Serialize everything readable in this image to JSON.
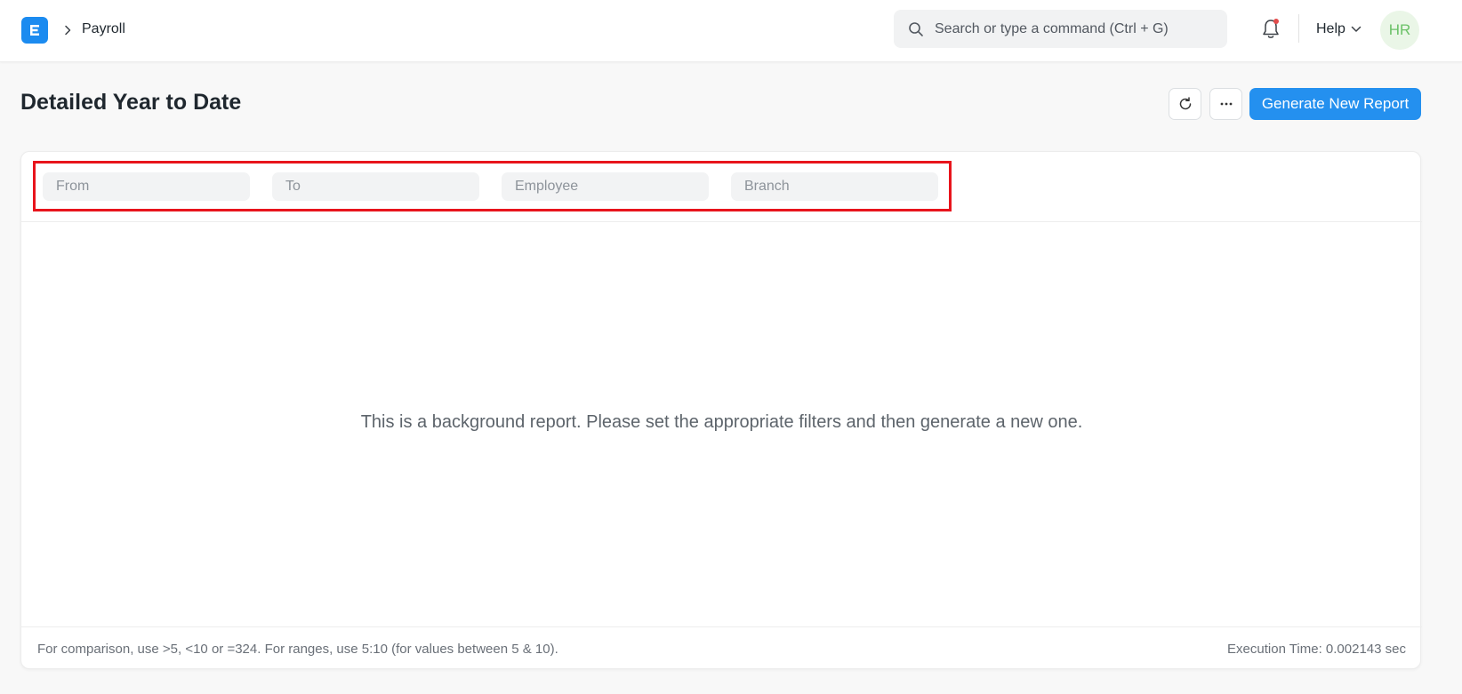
{
  "navbar": {
    "logo_letter": "E",
    "breadcrumb": "Payroll",
    "search_placeholder": "Search or type a command (Ctrl + G)",
    "help_label": "Help",
    "avatar_initials": "HR",
    "accent_color": "#2490ef",
    "notification_dot_color": "#e24c4c"
  },
  "page": {
    "title": "Detailed Year to Date",
    "refresh_icon": "refresh-icon",
    "more_icon": "ellipsis-icon",
    "primary_action": "Generate New Report"
  },
  "filters": {
    "from_placeholder": "From",
    "to_placeholder": "To",
    "employee_placeholder": "Employee",
    "branch_placeholder": "Branch",
    "highlight_color": "#e8141c"
  },
  "report": {
    "message": "This is a background report. Please set the appropriate filters and then generate a new one."
  },
  "footer": {
    "hint": "For comparison, use >5, <10 or =324. For ranges, use 5:10 (for values between 5 & 10).",
    "execution_time": "Execution Time: 0.002143 sec"
  }
}
